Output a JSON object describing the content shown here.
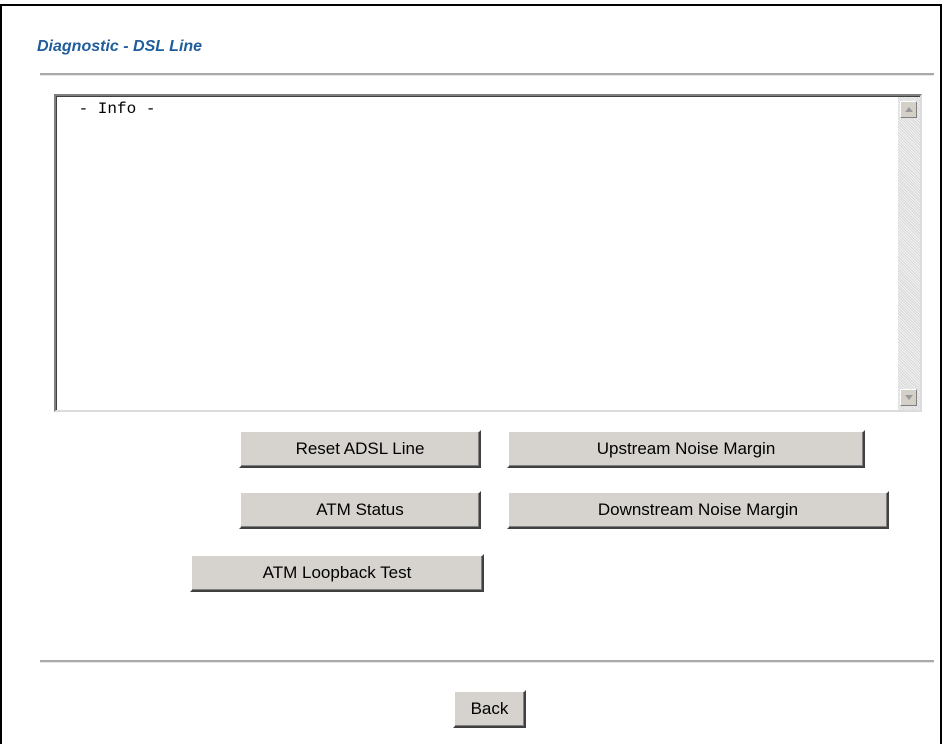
{
  "page": {
    "title": "Diagnostic - DSL Line"
  },
  "info_box": {
    "text": " - Info -"
  },
  "buttons": {
    "reset_adsl_line": "Reset ADSL Line",
    "upstream_noise_margin": "Upstream Noise Margin",
    "atm_status": "ATM Status",
    "downstream_noise_margin": "Downstream Noise Margin",
    "atm_loopback_test": "ATM Loopback Test",
    "back": "Back"
  },
  "colors": {
    "title": "#1f5d9c",
    "button_face": "#d6d3ce",
    "rule": "#a9a9a9"
  },
  "icons": {
    "scroll_up": "scroll-up-arrow-icon",
    "scroll_down": "scroll-down-arrow-icon"
  }
}
